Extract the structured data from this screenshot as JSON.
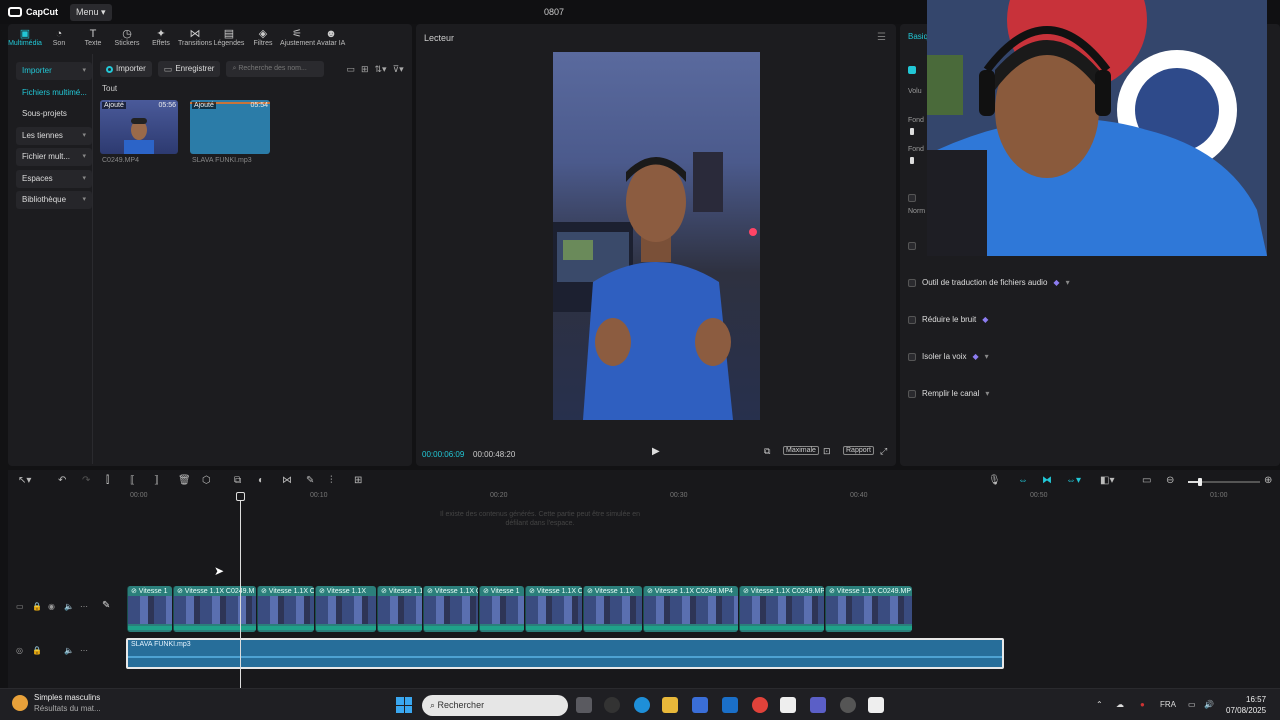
{
  "window": {
    "brand": "CapCut",
    "menu": "Menu",
    "title": "0807"
  },
  "toolbar": [
    {
      "icon": "media-icon",
      "glyph": "▣",
      "label": "Multimédia",
      "active": true
    },
    {
      "icon": "audio-icon",
      "glyph": "◔",
      "label": "Son"
    },
    {
      "icon": "text-icon",
      "glyph": "T",
      "label": "Texte"
    },
    {
      "icon": "sticker-icon",
      "glyph": "◷",
      "label": "Stickers"
    },
    {
      "icon": "effects-icon",
      "glyph": "✦",
      "label": "Effets"
    },
    {
      "icon": "transitions-icon",
      "glyph": "⋈",
      "label": "Transitions"
    },
    {
      "icon": "captions-icon",
      "glyph": "▤",
      "label": "Légendes"
    },
    {
      "icon": "filters-icon",
      "glyph": "◈",
      "label": "Filtres"
    },
    {
      "icon": "adjust-icon",
      "glyph": "⚟",
      "label": "Ajustement"
    },
    {
      "icon": "ai-avatar-icon",
      "glyph": "☻",
      "label": "Avatar IA"
    }
  ],
  "sidebar": [
    {
      "label": "Importer",
      "chevron": "▾",
      "active": true,
      "box": true
    },
    {
      "label": "Fichiers multimé...",
      "active": true
    },
    {
      "label": "Sous-projets"
    },
    {
      "label": "Les tiennes",
      "chevron": "▾",
      "box": true
    },
    {
      "label": "Fichier mult...",
      "chevron": "▾",
      "box": true
    },
    {
      "label": "Espaces",
      "chevron": "▾",
      "box": true
    },
    {
      "label": "Bibliothèque",
      "chevron": "▾",
      "box": true
    }
  ],
  "media": {
    "import": "Importer",
    "record": "Enregistrer",
    "search_placeholder": "Recherche des nom...",
    "filter_all": "Tout",
    "items": [
      {
        "tag": "Ajouté",
        "duration": "05:56",
        "name": "C0249.MP4"
      },
      {
        "tag": "Ajouté",
        "duration": "05:54",
        "name": "SLAVA FUNKI.mp3"
      }
    ]
  },
  "player": {
    "title": "Lecteur",
    "current_time": "00:00:06:09",
    "total_time": "00:00:48:20",
    "maximize": "Maximale",
    "ratio": "Rapport"
  },
  "properties": {
    "tab": "Basique",
    "volume_label": "Volu",
    "fade_in_label": "Fond",
    "fade_out_label": "Fond",
    "norm_label": "Norm",
    "options": [
      {
        "label": "Outil de traduction de fichiers audio",
        "premium": true,
        "dropdown": true
      },
      {
        "label": "Réduire le bruit",
        "premium": true
      },
      {
        "label": "Isoler la voix",
        "premium": true,
        "dropdown": true
      },
      {
        "label": "Remplir le canal",
        "dropdown": true
      }
    ]
  },
  "timeline": {
    "ruler": [
      "00:00",
      "00:10",
      "00:20",
      "00:30",
      "00:40",
      "00:50",
      "01:00"
    ],
    "hint": "Il existe des contenus générés. Cette partie peut être simulée en défilant dans l'espace.",
    "video_clips": [
      {
        "label": "Vitesse 1"
      },
      {
        "label": "Vitesse 1.1X C0249.M"
      },
      {
        "label": "Vitesse 1.1X C024"
      },
      {
        "label": "Vitesse 1.1X"
      },
      {
        "label": "Vitesse 1.1"
      },
      {
        "label": "Vitesse 1.1X C"
      },
      {
        "label": "Vitesse 1"
      },
      {
        "label": "Vitesse 1.1X C02"
      },
      {
        "label": "Vitesse 1.1X"
      },
      {
        "label": "Vitesse 1.1X C0249.MP4"
      },
      {
        "label": "Vitesse 1.1X C0249.MP4"
      },
      {
        "label": "Vitesse 1.1X C0249.MP"
      }
    ],
    "audio_clip": "SLAVA FUNKI.mp3"
  },
  "taskbar": {
    "weather_title": "Simples masculins",
    "weather_sub": "Résultats du mat...",
    "search": "Rechercher",
    "lang": "FRA",
    "time": "16:57",
    "date": "07/08/2025"
  }
}
